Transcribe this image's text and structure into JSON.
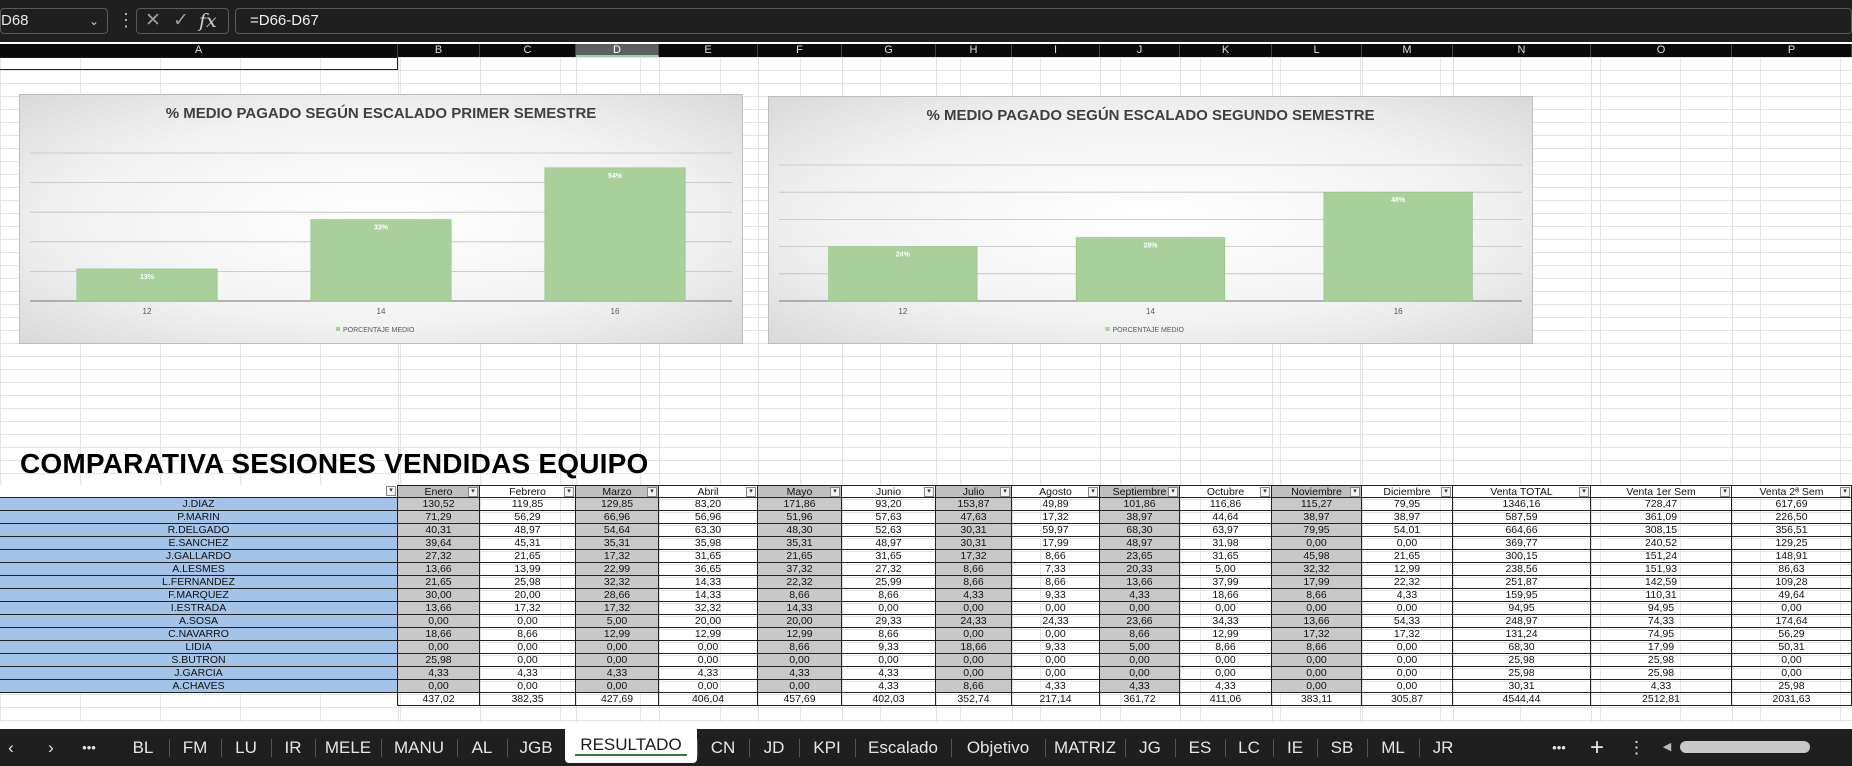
{
  "formula_bar": {
    "name_box": "D68",
    "more_icon": "⋮",
    "cancel_icon": "✕",
    "enter_icon": "✓",
    "fx_icon": "fx",
    "formula": "=D66-D67"
  },
  "columns": [
    "A",
    "B",
    "C",
    "D",
    "E",
    "F",
    "G",
    "H",
    "I",
    "J",
    "K",
    "L",
    "M",
    "N",
    "O",
    "P"
  ],
  "selected_column": "D",
  "charts": [
    {
      "title": "% MEDIO PAGADO SEGÚN ESCALADO PRIMER SEMESTRE",
      "legend": "PORCENTAJE MEDIO",
      "chart_data": {
        "type": "bar",
        "categories": [
          "12",
          "14",
          "16"
        ],
        "values": [
          13,
          33,
          54
        ],
        "labels": [
          "13%",
          "33%",
          "54%"
        ],
        "ylim": [
          0,
          60
        ]
      }
    },
    {
      "title": "% MEDIO PAGADO SEGÚN ESCALADO SEGUNDO SEMESTRE",
      "legend": "PORCENTAJE MEDIO",
      "chart_data": {
        "type": "bar",
        "categories": [
          "12",
          "14",
          "16"
        ],
        "values": [
          24,
          28,
          48
        ],
        "labels": [
          "24%",
          "28%",
          "48%"
        ],
        "ylim": [
          0,
          60
        ]
      }
    }
  ],
  "table_title": "COMPARATIVA SESIONES VENDIDAS EQUIPO",
  "table": {
    "headers": [
      "",
      "Enero",
      "Febrero",
      "Marzo",
      "Abril",
      "Mayo",
      "Junio",
      "Julio",
      "Agosto",
      "Septiembre",
      "Octubre",
      "Noviembre",
      "Diciembre",
      "Venta TOTAL",
      "Venta 1er Sem",
      "Venta 2ª Sem"
    ],
    "rows": [
      [
        "J.DIAZ",
        "130,52",
        "119,85",
        "129,85",
        "83,20",
        "171,86",
        "93,20",
        "153,87",
        "49,89",
        "101,86",
        "116,86",
        "115,27",
        "79,95",
        "1346,16",
        "728,47",
        "617,69"
      ],
      [
        "P.MARIN",
        "71,29",
        "56,29",
        "66,96",
        "56,96",
        "51,96",
        "57,63",
        "47,63",
        "17,32",
        "38,97",
        "44,64",
        "38,97",
        "38,97",
        "587,59",
        "361,09",
        "226,50"
      ],
      [
        "R.DELGADO",
        "40,31",
        "48,97",
        "54,64",
        "63,30",
        "48,30",
        "52,63",
        "30,31",
        "59,97",
        "68,30",
        "63,97",
        "79,95",
        "54,01",
        "664,66",
        "308,15",
        "356,51"
      ],
      [
        "E.SANCHEZ",
        "39,64",
        "45,31",
        "35,31",
        "35,98",
        "35,31",
        "48,97",
        "30,31",
        "17,99",
        "48,97",
        "31,98",
        "0,00",
        "0,00",
        "369,77",
        "240,52",
        "129,25"
      ],
      [
        "J.GALLARDO",
        "27,32",
        "21,65",
        "17,32",
        "31,65",
        "21,65",
        "31,65",
        "17,32",
        "8,66",
        "23,65",
        "31,65",
        "45,98",
        "21,65",
        "300,15",
        "151,24",
        "148,91"
      ],
      [
        "A.LESMES",
        "13,66",
        "13,99",
        "22,99",
        "36,65",
        "37,32",
        "27,32",
        "8,66",
        "7,33",
        "20,33",
        "5,00",
        "32,32",
        "12,99",
        "238,56",
        "151,93",
        "86,63"
      ],
      [
        "L.FERNANDEZ",
        "21,65",
        "25,98",
        "32,32",
        "14,33",
        "22,32",
        "25,99",
        "8,66",
        "8,66",
        "13,66",
        "37,99",
        "17,99",
        "22,32",
        "251,87",
        "142,59",
        "109,28"
      ],
      [
        "F.MARQUEZ",
        "30,00",
        "20,00",
        "28,66",
        "14,33",
        "8,66",
        "8,66",
        "4,33",
        "9,33",
        "4,33",
        "18,66",
        "8,66",
        "4,33",
        "159,95",
        "110,31",
        "49,64"
      ],
      [
        "I.ESTRADA",
        "13,66",
        "17,32",
        "17,32",
        "32,32",
        "14,33",
        "0,00",
        "0,00",
        "0,00",
        "0,00",
        "0,00",
        "0,00",
        "0,00",
        "94,95",
        "94,95",
        "0,00"
      ],
      [
        "A.SOSA",
        "0,00",
        "0,00",
        "5,00",
        "20,00",
        "20,00",
        "29,33",
        "24,33",
        "24,33",
        "23,66",
        "34,33",
        "13,66",
        "54,33",
        "248,97",
        "74,33",
        "174,64"
      ],
      [
        "C.NAVARRO",
        "18,66",
        "8,66",
        "12,99",
        "12,99",
        "12,99",
        "8,66",
        "0,00",
        "0,00",
        "8,66",
        "12,99",
        "17,32",
        "17,32",
        "131,24",
        "74,95",
        "56,29"
      ],
      [
        "LIDIA",
        "0,00",
        "0,00",
        "0,00",
        "0,00",
        "8,66",
        "9,33",
        "18,66",
        "9,33",
        "5,00",
        "8,66",
        "8,66",
        "0,00",
        "68,30",
        "17,99",
        "50,31"
      ],
      [
        "S.BUTRON",
        "25,98",
        "0,00",
        "0,00",
        "0,00",
        "0,00",
        "0,00",
        "0,00",
        "0,00",
        "0,00",
        "0,00",
        "0,00",
        "0,00",
        "25,98",
        "25,98",
        "0,00"
      ],
      [
        "J.GARCIA",
        "4,33",
        "4,33",
        "4,33",
        "4,33",
        "4,33",
        "4,33",
        "0,00",
        "0,00",
        "0,00",
        "0,00",
        "0,00",
        "0,00",
        "25,98",
        "25,98",
        "0,00"
      ],
      [
        "A.CHAVES",
        "0,00",
        "0,00",
        "0,00",
        "0,00",
        "0,00",
        "4,33",
        "8,66",
        "4,33",
        "4,33",
        "4,33",
        "0,00",
        "0,00",
        "30,31",
        "4,33",
        "25,98"
      ]
    ],
    "totals": [
      "",
      "437,02",
      "382,35",
      "427,69",
      "406,04",
      "457,69",
      "402,03",
      "352,74",
      "217,14",
      "361,72",
      "411,06",
      "383,11",
      "305,87",
      "4544,44",
      "2512,81",
      "2031,63"
    ]
  },
  "tabs": [
    "BL",
    "FM",
    "LU",
    "IR",
    "MELE",
    "MANU",
    "AL",
    "JGB",
    "RESULTADO",
    "CN",
    "JD",
    "KPI",
    "Escalado",
    "Objetivo",
    "MATRIZ",
    "JG",
    "ES",
    "LC",
    "IE",
    "SB",
    "ML",
    "JR"
  ],
  "active_tab": "RESULTADO",
  "tab_nav": {
    "prev": "‹",
    "next": "›",
    "more": "•••",
    "more_right": "•••",
    "add": "+",
    "menu": "⋮",
    "scroll_left": "◀"
  }
}
